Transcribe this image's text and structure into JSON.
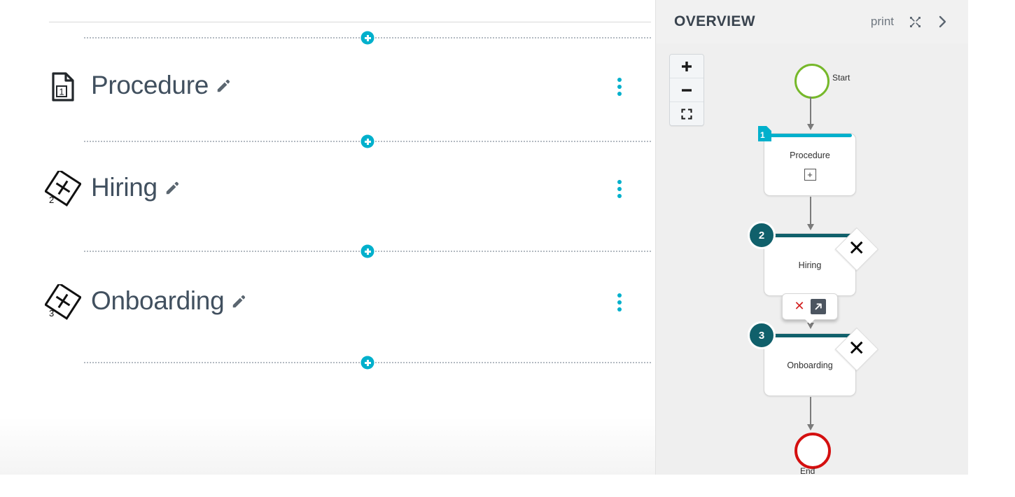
{
  "editor": {
    "steps": [
      {
        "index": "1",
        "title": "Procedure",
        "icon": "document-icon",
        "edit_icon": "pencil-icon",
        "menu_icon": "kebab-menu-icon"
      },
      {
        "index": "2",
        "title": "Hiring",
        "icon": "gateway-diamond-icon",
        "edit_icon": "pencil-icon",
        "menu_icon": "kebab-menu-icon"
      },
      {
        "index": "3",
        "title": "Onboarding",
        "icon": "gateway-diamond-icon",
        "edit_icon": "pencil-icon",
        "menu_icon": "kebab-menu-icon"
      }
    ],
    "add_step_icon": "plus-circle-icon",
    "separator_count": 4
  },
  "overview": {
    "title": "OVERVIEW",
    "print_label": "print",
    "expand_icon": "expand-arrows-icon",
    "collapse_icon": "chevron-right-icon",
    "zoom": {
      "in_label": "+",
      "out_label": "–",
      "fit_icon": "fit-to-screen-icon"
    },
    "diagram": {
      "start": {
        "label": "Start",
        "color": "#76b82a"
      },
      "end": {
        "label": "End",
        "color": "#d40f0f"
      },
      "nodes": [
        {
          "badge": "1",
          "label": "Procedure",
          "bar_color": "#00b0cc",
          "badge_type": "document",
          "expand_label": "+",
          "gateway": false
        },
        {
          "badge": "2",
          "label": "Hiring",
          "bar_color": "#10606b",
          "badge_type": "number",
          "gateway": true
        },
        {
          "badge": "3",
          "label": "Onboarding",
          "bar_color": "#10606b",
          "badge_type": "number",
          "gateway": true
        }
      ],
      "popover": {
        "delete_icon": "red-x-delete-icon",
        "open_icon": "open-external-arrow-icon"
      }
    }
  },
  "colors": {
    "accent_cyan": "#00b0cc",
    "accent_teal": "#10606b",
    "start_green": "#76b82a",
    "end_red": "#d40f0f",
    "text_dark": "#41505f"
  }
}
